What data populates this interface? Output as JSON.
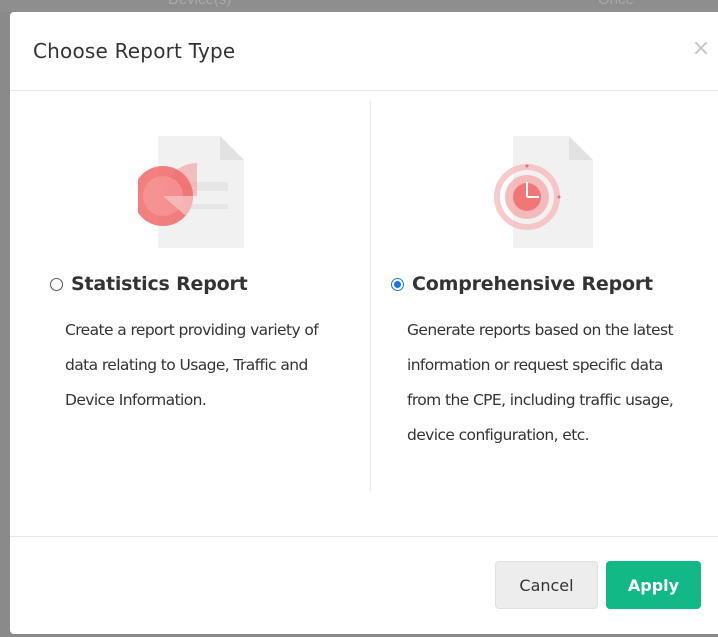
{
  "background": {
    "text_left": "Device(s)",
    "text_right": "Once"
  },
  "dialog": {
    "title": "Choose Report Type",
    "close_symbol": "×",
    "close_icon": "close-icon"
  },
  "options": [
    {
      "id": "statistics",
      "title": "Statistics Report",
      "description": "Create a report providing variety of data relating to Usage, Traffic and Device Information.",
      "selected": false,
      "icon": "document-pie-chart-icon"
    },
    {
      "id": "comprehensive",
      "title": "Comprehensive Report",
      "description": "Generate reports based on the latest information or request specific data from the CPE, including traffic usage, device configuration, etc.",
      "selected": true,
      "icon": "document-clock-icon"
    }
  ],
  "footer": {
    "cancel_label": "Cancel",
    "apply_label": "Apply"
  },
  "colors": {
    "accent_red": "#f06a6a",
    "apply_green": "#12b886",
    "radio_blue": "#1a73e8"
  }
}
